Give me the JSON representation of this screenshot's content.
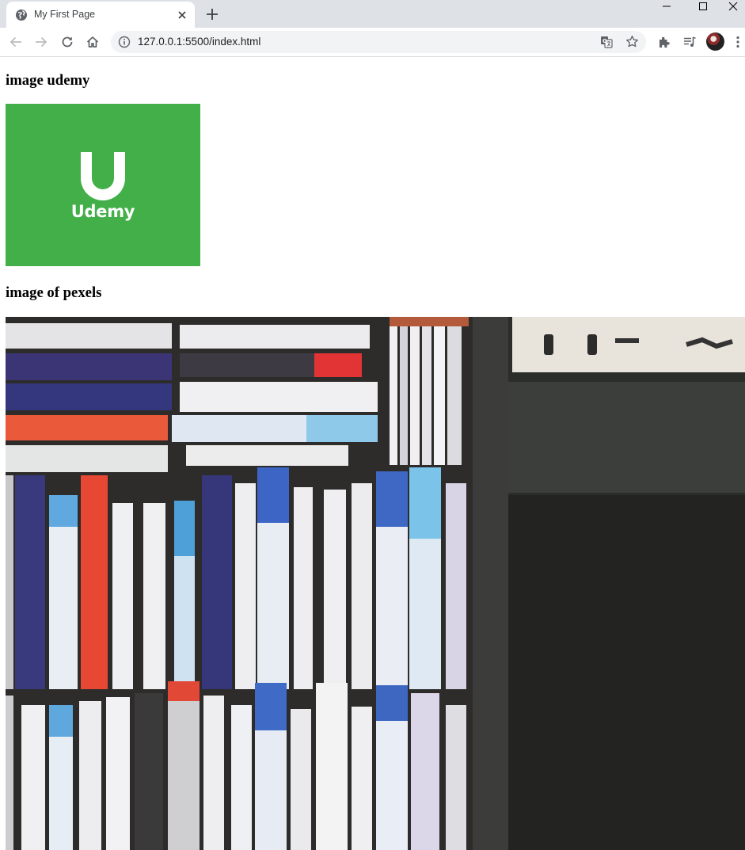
{
  "browser": {
    "tab_title": "My First Page",
    "url": "127.0.0.1:5500/index.html"
  },
  "page": {
    "heading_udemy": "image udemy",
    "udemy_logo": {
      "wordmark": "Udemy",
      "brand_color": "#43af49"
    },
    "heading_pexels": "image of pexels"
  },
  "icons": {
    "tab_favicon": "globe-icon",
    "tab_close": "close-icon",
    "new_tab": "plus-icon",
    "back": "arrow-left-icon",
    "forward": "arrow-right-icon",
    "reload": "reload-icon",
    "home": "home-icon",
    "site_info": "info-icon",
    "translate": "translate-icon",
    "bookmark": "star-icon",
    "extensions": "puzzle-icon",
    "media": "playlist-icon",
    "menu": "kebab-menu-icon"
  }
}
